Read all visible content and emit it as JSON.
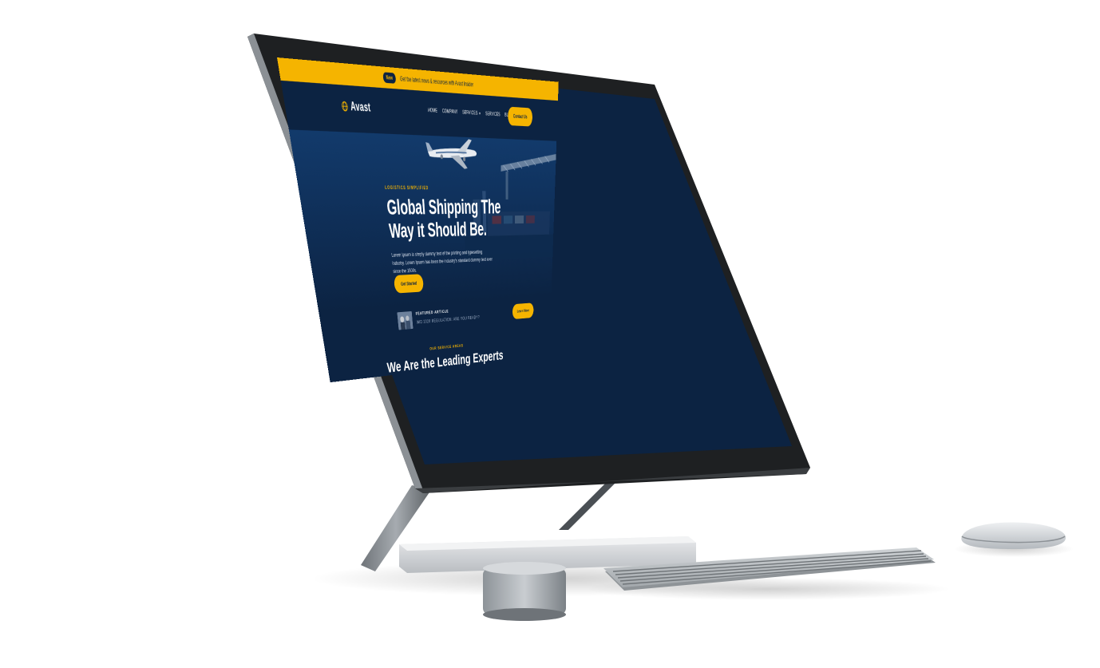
{
  "topbar": {
    "badge": "New",
    "message": "Get the latest news & resources with Avast Insider"
  },
  "brand": {
    "name": "Avast"
  },
  "nav": {
    "items": [
      "HOME",
      "COMPANY",
      "SERVICES",
      "SERVICES",
      "BLOG"
    ],
    "contact_label": "Contact Us"
  },
  "hero": {
    "eyebrow": "LOGISTICS SIMPLIFIED",
    "title_line1": "Global Shipping The",
    "title_line2": "Way it Should Be.",
    "text": "Lorem Ipsum is simply dummy text of the printing and typesetting industry. Lorem Ipsum has been the industry's standard dummy text ever since the 1500s.",
    "cta_label": "Get Started"
  },
  "featured": {
    "label": "FEATURED ARTICLE",
    "title": "IMO 2020 REGULATION: ARE YOU READY?",
    "cta_label": "Learn More"
  },
  "services": {
    "eyebrow": "OUR SERVICE AREAS",
    "title": "We Are the Leading Experts"
  },
  "colors": {
    "accent": "#f5b400",
    "navy": "#0c2342",
    "background": "#ffffff"
  }
}
